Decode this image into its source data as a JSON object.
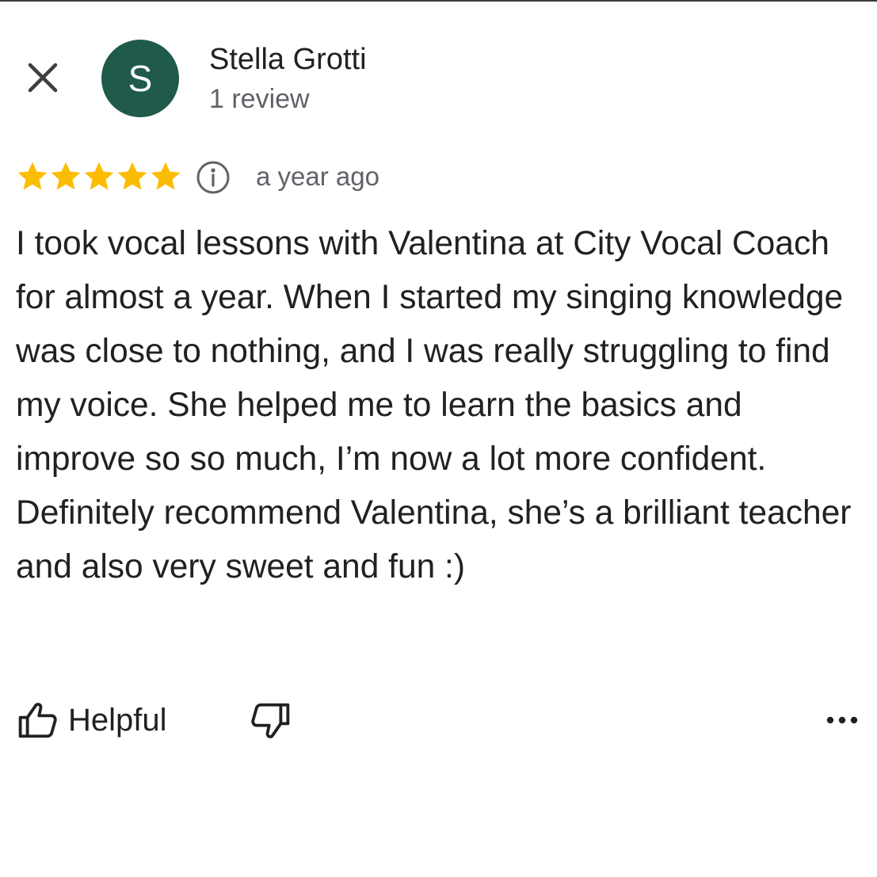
{
  "reviewer": {
    "name": "Stella Grotti",
    "initial": "S",
    "review_count": "1 review",
    "avatar_color": "#1f5a4a"
  },
  "review": {
    "rating": 5,
    "rating_max": 5,
    "star_color": "#fbbc04",
    "time": "a year ago",
    "text": "I took vocal lessons with Valentina at City Vocal Coach for almost a year. When I started my singing knowledge was close to nothing, and I was really struggling to find my voice. She helped me to learn the basics and improve so so much, I’m now a lot more confident. Definitely recommend Valentina, she’s a brilliant teacher and also very sweet and fun :)"
  },
  "actions": {
    "helpful_label": "Helpful",
    "helpful_icon": "thumbs-up-icon",
    "not_helpful_icon": "thumbs-down-icon",
    "more_icon": "more-horizontal-icon"
  },
  "header": {
    "close_icon": "close-icon",
    "info_icon": "info-icon"
  }
}
